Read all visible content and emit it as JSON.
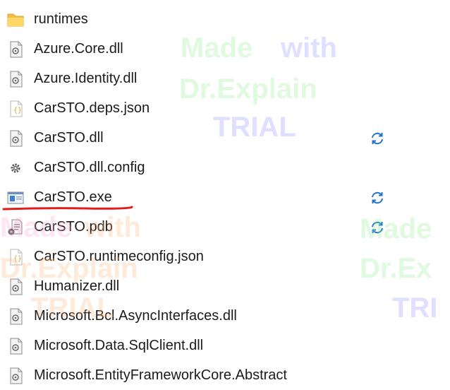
{
  "files": [
    {
      "name": "runtimes",
      "icon": "folder-icon",
      "sync": false
    },
    {
      "name": "Azure.Core.dll",
      "icon": "dll-file-icon",
      "sync": false
    },
    {
      "name": "Azure.Identity.dll",
      "icon": "dll-file-icon",
      "sync": false
    },
    {
      "name": "CarSTO.deps.json",
      "icon": "json-file-icon",
      "sync": false
    },
    {
      "name": "CarSTO.dll",
      "icon": "dll-file-icon",
      "sync": true
    },
    {
      "name": "CarSTO.dll.config",
      "icon": "config-file-icon",
      "sync": false
    },
    {
      "name": "CarSTO.exe",
      "icon": "exe-file-icon",
      "sync": true,
      "underlined": true
    },
    {
      "name": "CarSTO.pdb",
      "icon": "pdb-file-icon",
      "sync": true
    },
    {
      "name": "CarSTO.runtimeconfig.json",
      "icon": "json-file-icon",
      "sync": false
    },
    {
      "name": "Humanizer.dll",
      "icon": "dll-file-icon",
      "sync": false
    },
    {
      "name": "Microsoft.Bcl.AsyncInterfaces.dll",
      "icon": "dll-file-icon",
      "sync": false
    },
    {
      "name": "Microsoft.Data.SqlClient.dll",
      "icon": "dll-file-icon",
      "sync": false
    },
    {
      "name": "Microsoft.EntityFrameworkCore.Abstract",
      "icon": "dll-file-icon",
      "sync": false
    }
  ],
  "watermark": {
    "line1_a": "Made",
    "line1_b": "with",
    "line2": "Dr.Explain",
    "line3": "TRIAL",
    "right_line1": "Made",
    "right_line2": "Dr.Ex",
    "right_line3": "TRI"
  },
  "colors": {
    "folder": "#f2c04a",
    "sync": "#1e73c8",
    "underline": "#e01e1e",
    "exe_blue": "#3d7fd0"
  }
}
